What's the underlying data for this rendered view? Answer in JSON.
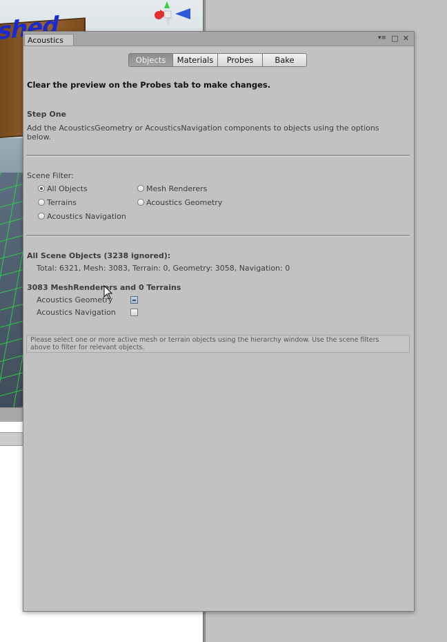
{
  "background": {
    "scene_text": "ished"
  },
  "window": {
    "tab_title": "Acoustics",
    "controls": {
      "menu": "▾≡",
      "maximize": "□",
      "close": "✕"
    }
  },
  "toolbar": {
    "tabs": [
      {
        "label": "Objects",
        "active": true
      },
      {
        "label": "Materials",
        "active": false
      },
      {
        "label": "Probes",
        "active": false
      },
      {
        "label": "Bake",
        "active": false
      }
    ]
  },
  "content": {
    "notice": "Clear the preview on the Probes tab to make changes.",
    "step_title": "Step One",
    "step_desc_line1": "Add the AcousticsGeometry or AcousticsNavigation components to objects using the options",
    "step_desc_line2": "below.",
    "scene_filter_label": "Scene Filter:",
    "filters": {
      "all_objects": "All Objects",
      "mesh_renderers": "Mesh Renderers",
      "terrains": "Terrains",
      "acoustics_geometry": "Acoustics Geometry",
      "acoustics_navigation": "Acoustics Navigation",
      "selected": "All Objects"
    },
    "all_scene_objects": "All Scene Objects (3238 ignored):",
    "totals": "Total: 6321, Mesh: 3083, Terrain: 0, Geometry: 3058, Navigation: 0",
    "mesh_summary": "3083 MeshRenderers and 0 Terrains",
    "acoustics_geometry_label": "Acoustics Geometry",
    "acoustics_geometry_state": "mixed",
    "acoustics_navigation_label": "Acoustics Navigation",
    "acoustics_navigation_state": "unchecked",
    "help_line1": "Please select one or more active mesh or terrain objects using the hierarchy window. Use the scene filters",
    "help_line2": "above to filter for relevant objects."
  },
  "colors": {
    "window_bg": "#c2c2c2",
    "active_tab": "#939393",
    "title_bar": "#a6a6a6"
  }
}
